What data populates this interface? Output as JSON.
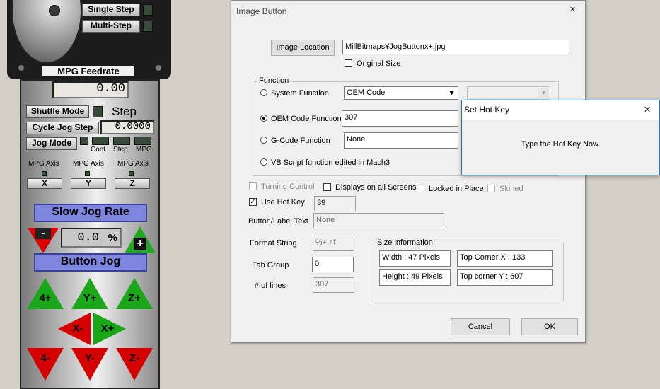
{
  "mach3": {
    "single_step": "Single Step",
    "multi_step": "Multi-Step",
    "mpg_feedrate": "MPG Feedrate",
    "feedrate_value": "0.00",
    "shuttle_mode": "Shuttle Mode",
    "step": "Step",
    "cycle_jog_step": "Cycle Jog Step",
    "cycle_value": "0.0000",
    "jog_mode": "Jog Mode",
    "cont": "Cont.",
    "step_small": "Step",
    "mpg": "MPG",
    "mpg_axis_label": "MPG Axis",
    "axis_x": "X",
    "axis_y": "Y",
    "axis_z": "Z",
    "slow_jog_rate": "Slow Jog Rate",
    "jog_minus": "-",
    "jog_plus": "+",
    "jog_rate_value": "0.0",
    "percent": "%",
    "button_jog": "Button Jog",
    "btn_4plus": "4+",
    "btn_yplus": "Y+",
    "btn_zplus": "Z+",
    "btn_xminus": "X-",
    "btn_xplus": "X+",
    "btn_4minus": "4-",
    "btn_yminus": "Y-",
    "btn_zminus": "Z-"
  },
  "image_button": {
    "title": "Image Button",
    "image_location_button": "Image Location",
    "image_location_value": "MillBitmaps¥JogButtonx+.jpg",
    "original_size": "Original Size",
    "function_group": "Function",
    "system_function": "System Function",
    "system_function_value": "OEM Code",
    "oem_code_function": "OEM Code Function",
    "oem_code_value": "307",
    "gcode_function": "G-Code Function",
    "gcode_value": "None",
    "vb_script": "VB Script function edited in Mach3",
    "turning_control": "Turning Control",
    "displays_all": "Displays on all Screens",
    "locked_in_place": "Locked in Place",
    "skined": "Skined",
    "use_hot_key": "Use Hot Key",
    "hot_key_value": "39",
    "button_label_text": "Button/Label Text",
    "button_label_value": "None",
    "format_string": "Format String",
    "format_value": "%+.4f",
    "tab_group": "Tab Group",
    "tab_group_value": "0",
    "num_lines": "# of lines",
    "num_lines_value": "307",
    "size_info": "Size information",
    "width": "Width : 47 Pixels",
    "height": "Height : 49 Pixels",
    "top_corner_x": "Top Corner X : 133",
    "top_corner_y": "Top corner Y : 607",
    "cancel": "Cancel",
    "ok": "OK"
  },
  "hot_key": {
    "title": "Set Hot Key",
    "message": "Type the Hot Key Now."
  },
  "icons": {
    "close": "×",
    "check": "✓",
    "dropdown": "▾"
  }
}
